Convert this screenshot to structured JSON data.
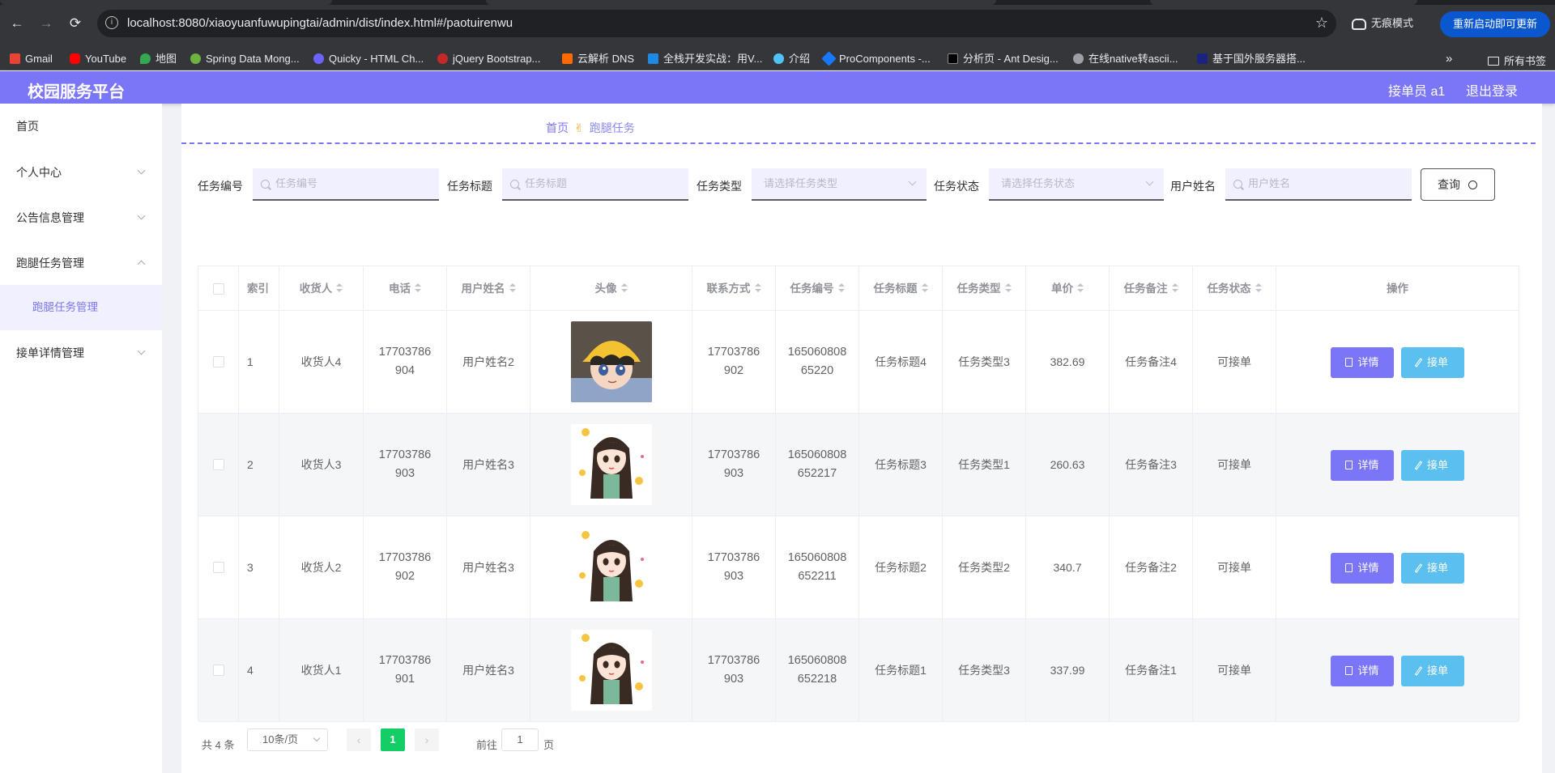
{
  "browser": {
    "url": "localhost:8080/xiaoyuanfuwupingtai/admin/dist/index.html#/paotuirenwu",
    "incognito_label": "无痕模式",
    "relaunch_label": "重新启动即可更新",
    "bookmarks": [
      "Gmail",
      "YouTube",
      "地图",
      "Spring Data Mong...",
      "Quicky - HTML Ch...",
      "jQuery Bootstrap...",
      "云解析 DNS",
      "全栈开发实战：用V...",
      "介绍",
      "ProComponents -...",
      "分析页 - Ant Desig...",
      "在线native转ascii...",
      "基于国外服务器搭..."
    ],
    "bookmarks_more": "»",
    "all_bookmarks": "所有书签"
  },
  "header": {
    "title": "校园服务平台",
    "user": "接单员 a1",
    "logout": "退出登录"
  },
  "sidebar": {
    "items": [
      {
        "label": "首页"
      },
      {
        "label": "个人中心"
      },
      {
        "label": "公告信息管理"
      },
      {
        "label": "跑腿任务管理"
      },
      {
        "label": "跑腿任务管理"
      },
      {
        "label": "接单详情管理"
      }
    ]
  },
  "breadcrumb": {
    "home": "首页",
    "current": "跑腿任务"
  },
  "search": {
    "task_no_label": "任务编号",
    "task_no_placeholder": "任务编号",
    "task_title_label": "任务标题",
    "task_title_placeholder": "任务标题",
    "task_type_label": "任务类型",
    "task_type_placeholder": "请选择任务类型",
    "task_status_label": "任务状态",
    "task_status_placeholder": "请选择任务状态",
    "user_name_label": "用户姓名",
    "user_name_placeholder": "用户姓名",
    "query_label": "查询"
  },
  "table": {
    "headers": {
      "index": "索引",
      "receiver": "收货人",
      "phone": "电话",
      "user_name": "用户姓名",
      "avatar": "头像",
      "contact": "联系方式",
      "task_no": "任务编号",
      "task_title": "任务标题",
      "task_type": "任务类型",
      "price": "单价",
      "task_note": "任务备注",
      "task_status": "任务状态",
      "actions": "操作"
    },
    "rows": [
      {
        "index": "1",
        "receiver": "收货人4",
        "phone": "17703786904",
        "user_name": "用户姓名2",
        "avatar": "boy-yellow-hat",
        "contact": "17703786902",
        "task_no": "16506080865220",
        "task_title": "任务标题4",
        "task_type": "任务类型3",
        "price": "382.69",
        "task_note": "任务备注4",
        "task_status": "可接单"
      },
      {
        "index": "2",
        "receiver": "收货人3",
        "phone": "17703786903",
        "user_name": "用户姓名3",
        "avatar": "girl-long-hair",
        "contact": "17703786903",
        "task_no": "165060808652217",
        "task_title": "任务标题3",
        "task_type": "任务类型1",
        "price": "260.63",
        "task_note": "任务备注3",
        "task_status": "可接单"
      },
      {
        "index": "3",
        "receiver": "收货人2",
        "phone": "17703786902",
        "user_name": "用户姓名3",
        "avatar": "girl-long-hair",
        "contact": "17703786903",
        "task_no": "165060808652211",
        "task_title": "任务标题2",
        "task_type": "任务类型2",
        "price": "340.7",
        "task_note": "任务备注2",
        "task_status": "可接单"
      },
      {
        "index": "4",
        "receiver": "收货人1",
        "phone": "17703786901",
        "user_name": "用户姓名3",
        "avatar": "girl-long-hair",
        "contact": "17703786903",
        "task_no": "165060808652218",
        "task_title": "任务标题1",
        "task_type": "任务类型3",
        "price": "337.99",
        "task_note": "任务备注1",
        "task_status": "可接单"
      }
    ],
    "detail_label": "详情",
    "take_label": "接单"
  },
  "pagination": {
    "total": "共 4 条",
    "page_size": "10条/页",
    "prev": "‹",
    "current_page": "1",
    "next": "›",
    "goto_label": "前往",
    "goto_value": "1",
    "page_unit": "页"
  },
  "colors": {
    "primary": "#7b76f7",
    "take_button": "#5bc0f0",
    "active_page": "#13ce66"
  }
}
